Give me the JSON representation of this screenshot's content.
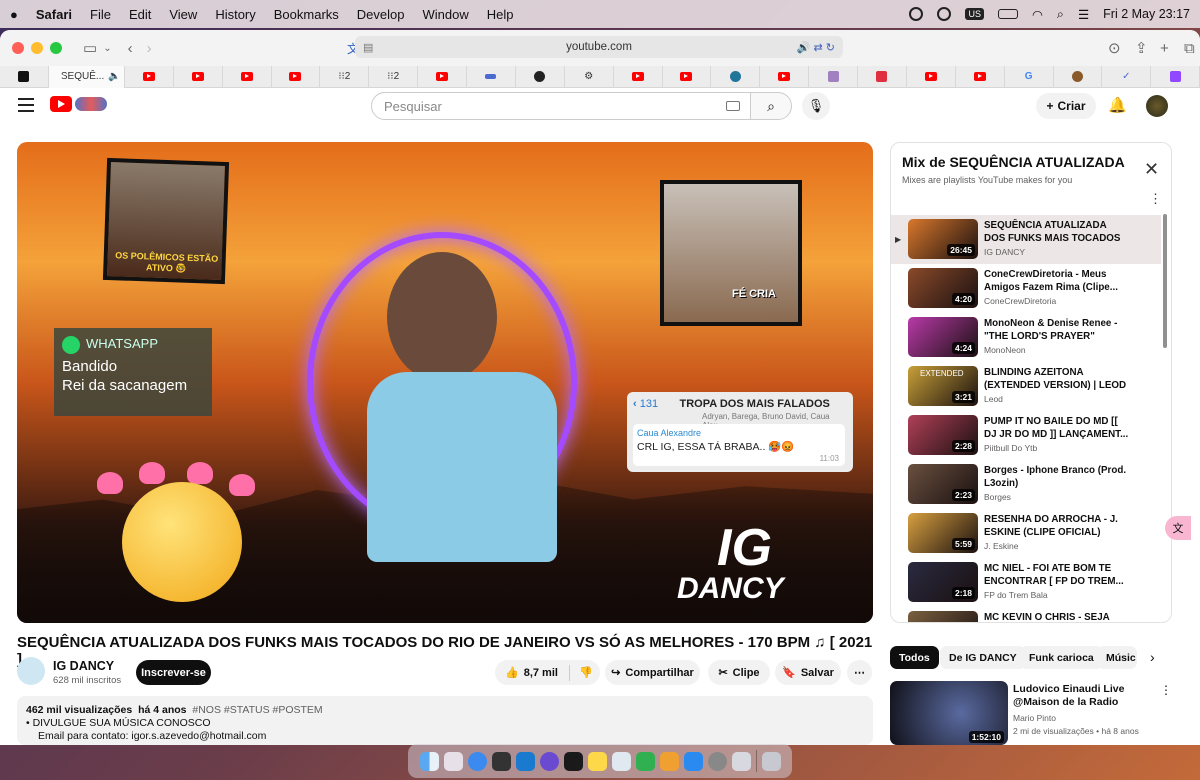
{
  "menubar": {
    "apple": "",
    "app": "Safari",
    "items": [
      "File",
      "Edit",
      "View",
      "History",
      "Bookmarks",
      "Develop",
      "Window",
      "Help"
    ],
    "input_source": "US",
    "clock": "Fri 2 May  23:17"
  },
  "browser": {
    "url": "youtube.com",
    "active_tab": "SEQUÊ..."
  },
  "yt": {
    "search_placeholder": "Pesquisar",
    "create_label": "Criar"
  },
  "thumbnail_text": {
    "whatsapp_title": "WHATSAPP",
    "whatsapp_line1": "Bandido",
    "whatsapp_line2": "Rei da sacanagem",
    "chat_back_count": "131",
    "chat_group": "TROPA DOS MAIS FALADOS",
    "chat_members": "Adryan, Barega, Bruno David, Caua Alex...",
    "chat_sender": "Caua Alexandre",
    "chat_message": "CRL IG, ESSA TÁ BRABA.. 🥵😡",
    "chat_time": "11:03",
    "sticker_top": "OS POLÊMICOS ESTÃO ATIVO 🤓",
    "sticker_right": "FÉ CRIA",
    "brand_top": "IG",
    "brand_bottom": "DANCY"
  },
  "video": {
    "title": "SEQUÊNCIA ATUALIZADA DOS FUNKS MAIS TOCADOS DO RIO DE JANEIRO VS SÓ AS MELHORES - 170 BPM ♫ [ 2021 ]",
    "channel": "IG DANCY",
    "subscribers": "628 mil inscritos",
    "subscribe_label": "Inscrever-se",
    "likes": "8,7 mil",
    "share_label": "Compartilhar",
    "clip_label": "Clipe",
    "save_label": "Salvar",
    "views": "462 mil visualizações",
    "age": "há 4 anos",
    "tags": "#NOS #STATUS #POSTEM",
    "desc_line1": "• DIVULGUE SUA MÚSICA CONOSCO",
    "desc_line2": "Email para contato: igor.s.azevedo@hotmail.com"
  },
  "mix": {
    "title": "Mix de SEQUÊNCIA ATUALIZADA DOS FUNKS MAIS TOCADOS DO RIO DE JANEIRO",
    "subtitle": "Mixes are playlists YouTube makes for you",
    "items": [
      {
        "title": "SEQUÊNCIA ATUALIZADA DOS FUNKS MAIS TOCADOS DO...",
        "channel": "IG DANCY",
        "duration": "26:45",
        "color": "#d9782c"
      },
      {
        "title": "ConeCrewDiretoria - Meus Amigos Fazem Rima (Clipe...",
        "channel": "ConeCrewDiretoria",
        "duration": "4:20",
        "color": "#8a4a2a"
      },
      {
        "title": "MonoNeon & Denise Renee - \"THE LORD'S PRAYER\"",
        "channel": "MonoNeon",
        "duration": "4:24",
        "color": "#b83aa8"
      },
      {
        "title": "BLINDING AZEITONA (EXTENDED VERSION) | LEOD",
        "channel": "Leod",
        "duration": "3:21",
        "color": "#c8a038",
        "badge": "EXTENDED"
      },
      {
        "title": "PUMP IT NO BAILE DO MD [[ DJ JR DO MD ]] LANÇAMENT...",
        "channel": "Piitbull Do Ytb",
        "duration": "2:28",
        "color": "#b04058"
      },
      {
        "title": "Borges - Iphone Branco (Prod. L3ozin)",
        "channel": "Borges",
        "duration": "2:23",
        "color": "#6a5040"
      },
      {
        "title": "RESENHA DO ARROCHA - J. ESKINE (CLIPE OFICIAL)",
        "channel": "J. Eskine",
        "duration": "5:59",
        "color": "#d8a040"
      },
      {
        "title": "MC NIEL - FOI ATE BOM TE ENCONTRAR [ FP DO TREM...",
        "channel": "FP do Trem Bala",
        "duration": "2:18",
        "color": "#2a2a40"
      },
      {
        "title": "MC KEVIN O CHRIS - SEJA",
        "channel": "",
        "duration": "",
        "color": "#7a6040"
      }
    ]
  },
  "chips": [
    "Todos",
    "De IG DANCY",
    "Funk carioca",
    "Músic"
  ],
  "recommended": {
    "title": "Ludovico Einaudi Live @Maison de la Radio",
    "channel": "Mario Pinto",
    "stats": "2 mi de visualizações  •  há 8 anos",
    "duration": "1:52:10"
  },
  "colors": {
    "yt_red": "#ff0000",
    "accent_purple": "#a44bff"
  }
}
